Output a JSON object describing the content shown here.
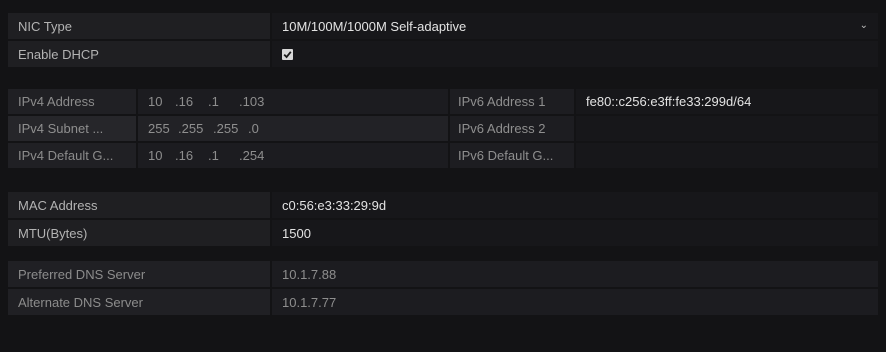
{
  "nic_type": {
    "label": "NIC Type",
    "value": "10M/100M/1000M Self-adaptive"
  },
  "enable_dhcp": {
    "label": "Enable DHCP",
    "checked": true
  },
  "ipv4_address": {
    "label": "IPv4 Address",
    "segments": [
      "10",
      ".16",
      ".1",
      ".103"
    ]
  },
  "ipv4_subnet": {
    "label": "IPv4 Subnet ...",
    "segments": [
      "255",
      ".255",
      ".255",
      ".0"
    ]
  },
  "ipv4_gateway": {
    "label": "IPv4 Default G...",
    "segments": [
      "10",
      ".16",
      ".1",
      ".254"
    ]
  },
  "ipv6_address_1": {
    "label": "IPv6 Address 1",
    "value": "fe80::c256:e3ff:fe33:299d/64"
  },
  "ipv6_address_2": {
    "label": "IPv6 Address 2",
    "value": ""
  },
  "ipv6_gateway": {
    "label": "IPv6 Default G...",
    "value": ""
  },
  "mac_address": {
    "label": "MAC Address",
    "value": "c0:56:e3:33:29:9d"
  },
  "mtu": {
    "label": "MTU(Bytes)",
    "value": "1500"
  },
  "preferred_dns": {
    "label": "Preferred DNS Server",
    "value": "10.1.7.88"
  },
  "alternate_dns": {
    "label": "Alternate DNS Server",
    "value": "10.1.7.77"
  },
  "colors": {
    "background": "#131315",
    "label_bg": "#1f1f22",
    "value_bg": "#17171a",
    "text_bright": "#e3e3e3",
    "text_dim": "#8f8f8f"
  }
}
